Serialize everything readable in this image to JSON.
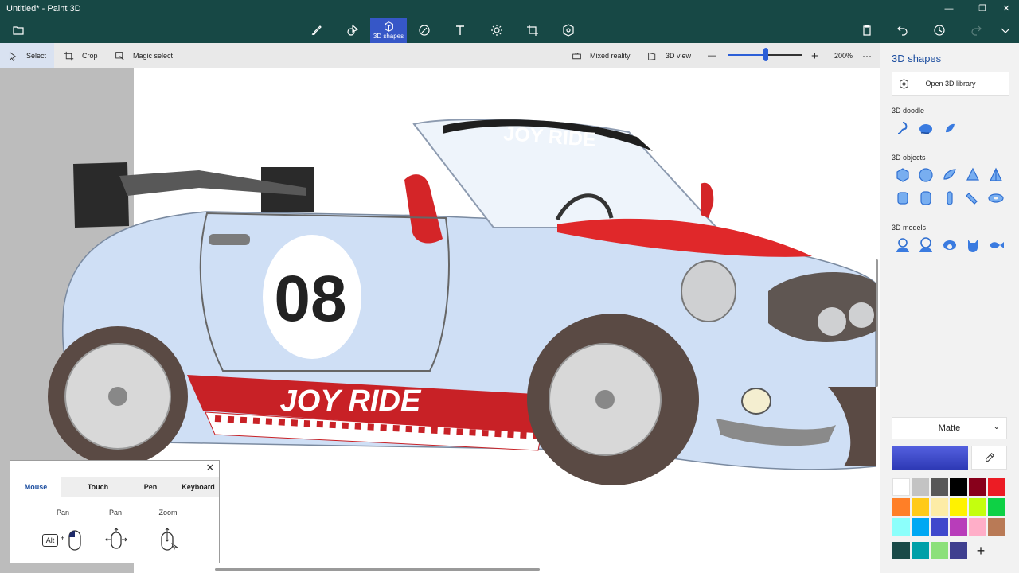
{
  "window": {
    "title": "Untitled* - Paint 3D",
    "minimize_glyph": "—",
    "maximize_glyph": "❐",
    "close_glyph": "✕"
  },
  "toolbar": {
    "menu_icon": "folder-icon",
    "tools": [
      {
        "name": "brushes",
        "icon": "brush-icon"
      },
      {
        "name": "2d-shapes",
        "icon": "2d-shapes-icon"
      },
      {
        "name": "3d-shapes",
        "icon": "cube-icon",
        "label": "3D shapes",
        "active": true
      },
      {
        "name": "stickers",
        "icon": "sticker-icon"
      },
      {
        "name": "text",
        "icon": "text-icon"
      },
      {
        "name": "effects",
        "icon": "sun-icon"
      },
      {
        "name": "canvas",
        "icon": "crop-canvas-icon"
      },
      {
        "name": "3d-library",
        "icon": "3d-library-icon"
      }
    ],
    "right_icons": [
      "paste-icon",
      "undo-icon",
      "history-icon",
      "redo-icon",
      "expand-icon"
    ]
  },
  "subbar": {
    "select": "Select",
    "crop": "Crop",
    "magic_select": "Magic select",
    "mixed_reality": "Mixed reality",
    "view_3d": "3D view",
    "zoom_minus": "—",
    "zoom_plus": "+",
    "zoom_percent": "200%",
    "zoom_slider_level": 0.52,
    "more": "···"
  },
  "canvas": {
    "car_banner_top": "JOY RIDE",
    "car_number": "08",
    "car_banner_side": "JOY RIDE"
  },
  "help": {
    "close_glyph": "✕",
    "tabs": [
      "Mouse",
      "Touch",
      "Pen",
      "Keyboard"
    ],
    "active_tab": "Mouse",
    "columns": [
      {
        "label": "Pan",
        "key": "Alt",
        "plus": "+"
      },
      {
        "label": "Pan"
      },
      {
        "label": "Zoom"
      }
    ]
  },
  "panel": {
    "title": "3D shapes",
    "library_button": "Open 3D library",
    "doodle_title": "3D doodle",
    "doodle_icons": [
      "sharp-edge-doodle-icon",
      "soft-edge-doodle-icon",
      "tube-doodle-icon"
    ],
    "objects_title": "3D objects",
    "objects_icons": [
      "cube-icon",
      "sphere-icon",
      "hemisphere-icon",
      "cone-icon",
      "pyramid-icon",
      "cylinder-icon",
      "tube-icon",
      "capsule-icon",
      "curved-cylinder-icon",
      "donut-icon"
    ],
    "models_title": "3D models",
    "models_icons": [
      "man-model-icon",
      "woman-model-icon",
      "dog-model-icon",
      "cat-model-icon",
      "fish-model-icon"
    ],
    "finish": "Matte",
    "finish_chevron": "⌄",
    "selected_color": "#3b46cc",
    "palette": [
      "#ffffff",
      "#c3c3c3",
      "#585858",
      "#000000",
      "#88001b",
      "#ec1c24",
      "#ff7f27",
      "#ffca18",
      "#fdeca6",
      "#fff200",
      "#c4ff0e",
      "#0ed145",
      "#8cfffb",
      "#00a8f3",
      "#3f48cc",
      "#b83dba",
      "#ffaec8",
      "#b97a56"
    ],
    "custom_colors": [
      "#1a4a48",
      "#00a0a8",
      "#8ce07a",
      "#3f3f8f"
    ],
    "add_color_glyph": "+"
  }
}
